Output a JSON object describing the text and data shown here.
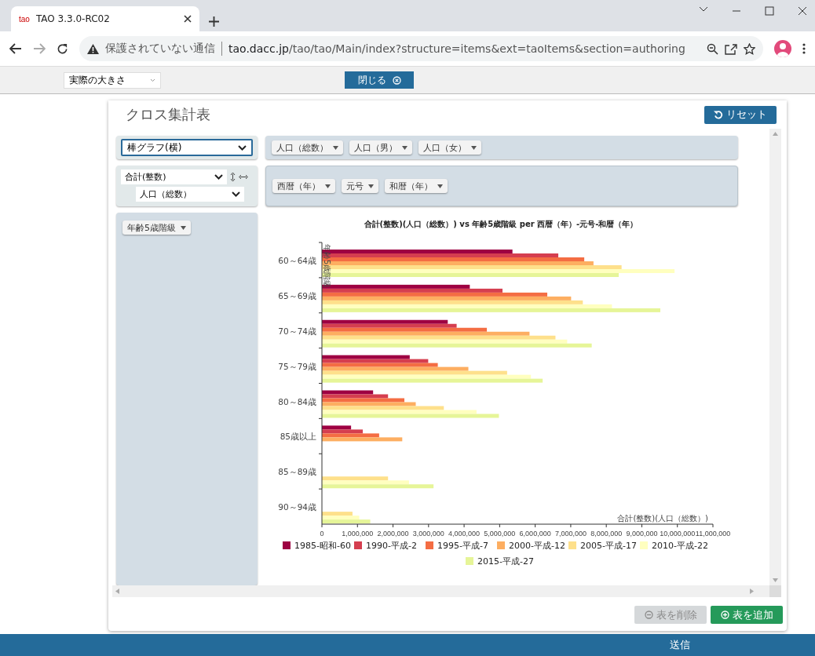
{
  "browser": {
    "tab_title": "TAO 3.3.0-RC02",
    "tab_logo": "tao",
    "url_warning": "保護されていない通信",
    "url_domain": "tao.dacc.jp",
    "url_path": "/tao/tao/Main/index?structure=items&ext=taoItems&section=authoring"
  },
  "toolbar": {
    "zoom_select": "実際の大きさ",
    "close_button": "閉じる"
  },
  "widget": {
    "title": "クロス集計表",
    "reset_button": "リセット",
    "chart_type": "棒グラフ(横)",
    "measure": "合計(整数)",
    "measure_field": "人口（総数）",
    "column_pills": [
      "人口（総数）",
      "人口（男）",
      "人口（女）"
    ],
    "row_dim_pills": [
      "西暦（年）",
      "元号",
      "和暦（年）"
    ],
    "row_pills": [
      "年齢5歳階級"
    ],
    "chart_data": {
      "type": "bar",
      "orientation": "horizontal",
      "title": "合計(整数)(人口（総数）) vs 年齢5歳階級 per 西暦（年）-元号-和暦（年）",
      "xlabel": "合計(整数)(人口（総数）)",
      "ylabel": "年齢5歳階級",
      "categories": [
        "60～64歳",
        "65～69歳",
        "70～74歳",
        "75～79歳",
        "80～84歳",
        "85歳以上",
        "85～89歳",
        "90～94歳"
      ],
      "series": [
        {
          "name": "1985-昭和-60",
          "color": "#9e0142",
          "values": [
            5360000,
            4160000,
            3540000,
            2470000,
            1440000,
            820000,
            null,
            null
          ]
        },
        {
          "name": "1990-平成-2",
          "color": "#d53e4f",
          "values": [
            6650000,
            5080000,
            3790000,
            2990000,
            1860000,
            1150000,
            null,
            null
          ]
        },
        {
          "name": "1995-平成-7",
          "color": "#f46d43",
          "values": [
            7380000,
            6340000,
            4640000,
            3260000,
            2320000,
            1610000,
            null,
            null
          ]
        },
        {
          "name": "2000-平成-12",
          "color": "#fdae61",
          "values": [
            7640000,
            7010000,
            5840000,
            4120000,
            2640000,
            2260000,
            null,
            null
          ]
        },
        {
          "name": "2005-平成-17",
          "color": "#fee08b",
          "values": [
            8430000,
            7340000,
            6570000,
            5210000,
            3430000,
            null,
            1860000,
            860000
          ]
        },
        {
          "name": "2010-平成-22",
          "color": "#ffffbf",
          "values": [
            9920000,
            8160000,
            6900000,
            5880000,
            4350000,
            null,
            2450000,
            1050000
          ]
        },
        {
          "name": "2015-平成-27",
          "color": "#e6f598",
          "values": [
            8350000,
            9520000,
            7590000,
            6210000,
            4980000,
            null,
            3140000,
            1360000
          ]
        }
      ],
      "legend": true,
      "xlim": [
        0,
        11000000
      ],
      "xticks": [
        {
          "value": 0,
          "label": "0"
        },
        {
          "value": 1000000,
          "label": "1,000,000"
        },
        {
          "value": 2000000,
          "label": "2,000,000"
        },
        {
          "value": 3000000,
          "label": "3,000,000"
        },
        {
          "value": 4000000,
          "label": "4,000,000"
        },
        {
          "value": 5000000,
          "label": "5,000,000"
        },
        {
          "value": 6000000,
          "label": "6,000,000"
        },
        {
          "value": 7000000,
          "label": "7,000,000"
        },
        {
          "value": 8000000,
          "label": "8,000,000"
        },
        {
          "value": 9000000,
          "label": "9,000,000"
        },
        {
          "value": 10000000,
          "label": "10,000,000"
        },
        {
          "value": 11000000,
          "label": "11,000,000"
        }
      ]
    },
    "remove_button": {
      "label": "表を削除",
      "disabled": true
    },
    "add_button": {
      "label": "表を追加"
    }
  },
  "footer": {
    "submit": "送信"
  }
}
